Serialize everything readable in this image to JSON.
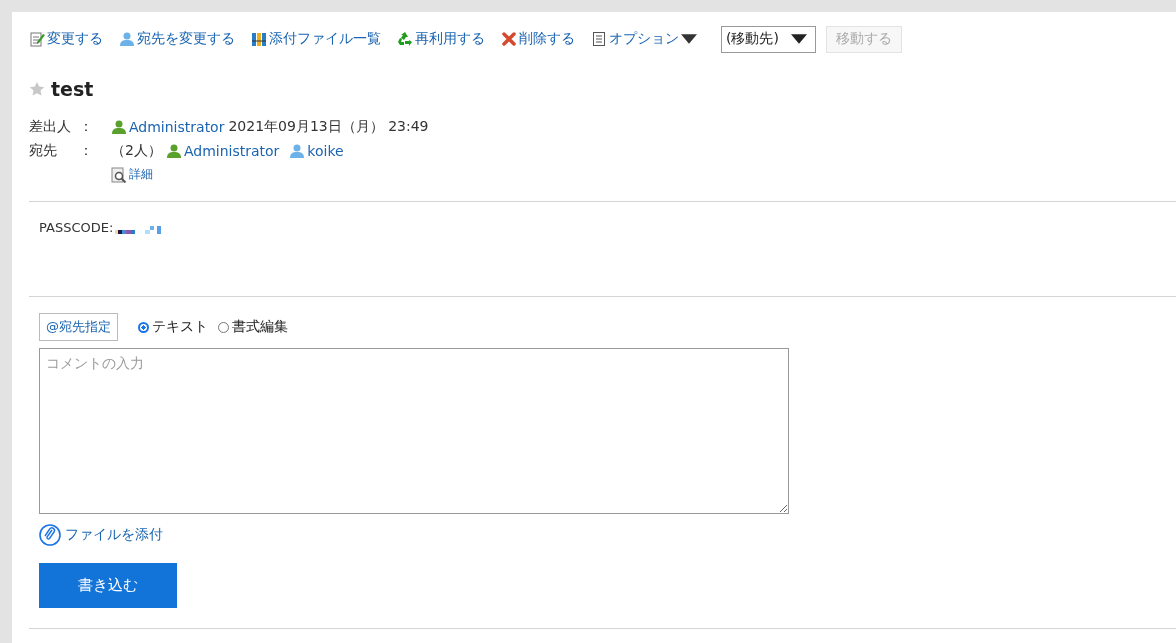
{
  "toolbar": [
    {
      "kind": "edit",
      "label": "変更する"
    },
    {
      "kind": "person",
      "label": "宛先を変更する"
    },
    {
      "kind": "binders",
      "label": "添付ファイル一覧"
    },
    {
      "kind": "recycle",
      "label": "再利用する"
    },
    {
      "kind": "delete",
      "label": "削除する"
    },
    {
      "kind": "options",
      "label": "オプション"
    }
  ],
  "move": {
    "select": "(移動先)",
    "button": "移動する",
    "button_disabled": true
  },
  "title": {
    "text": "test",
    "starred": false
  },
  "sender": {
    "label": "差出人",
    "colon": "：",
    "name": "Administrator",
    "date": "2021年09月13日（月） 23:49"
  },
  "recipients": {
    "label": "宛先",
    "colon": "：",
    "count": "（2人）",
    "people": [
      {
        "name": "Administrator",
        "kind": "admin"
      },
      {
        "name": "koike",
        "kind": "user"
      }
    ],
    "detail": "詳細"
  },
  "body": {
    "text": "PASSCODE:"
  },
  "comment": {
    "mention": "宛先指定",
    "mention_mark": "@",
    "formats": [
      {
        "label": "テキスト",
        "selected": true
      },
      {
        "label": "書式編集",
        "selected": false
      }
    ],
    "placeholder": "コメントの入力",
    "attach": "ファイルを添付",
    "submit": "書き込む"
  }
}
